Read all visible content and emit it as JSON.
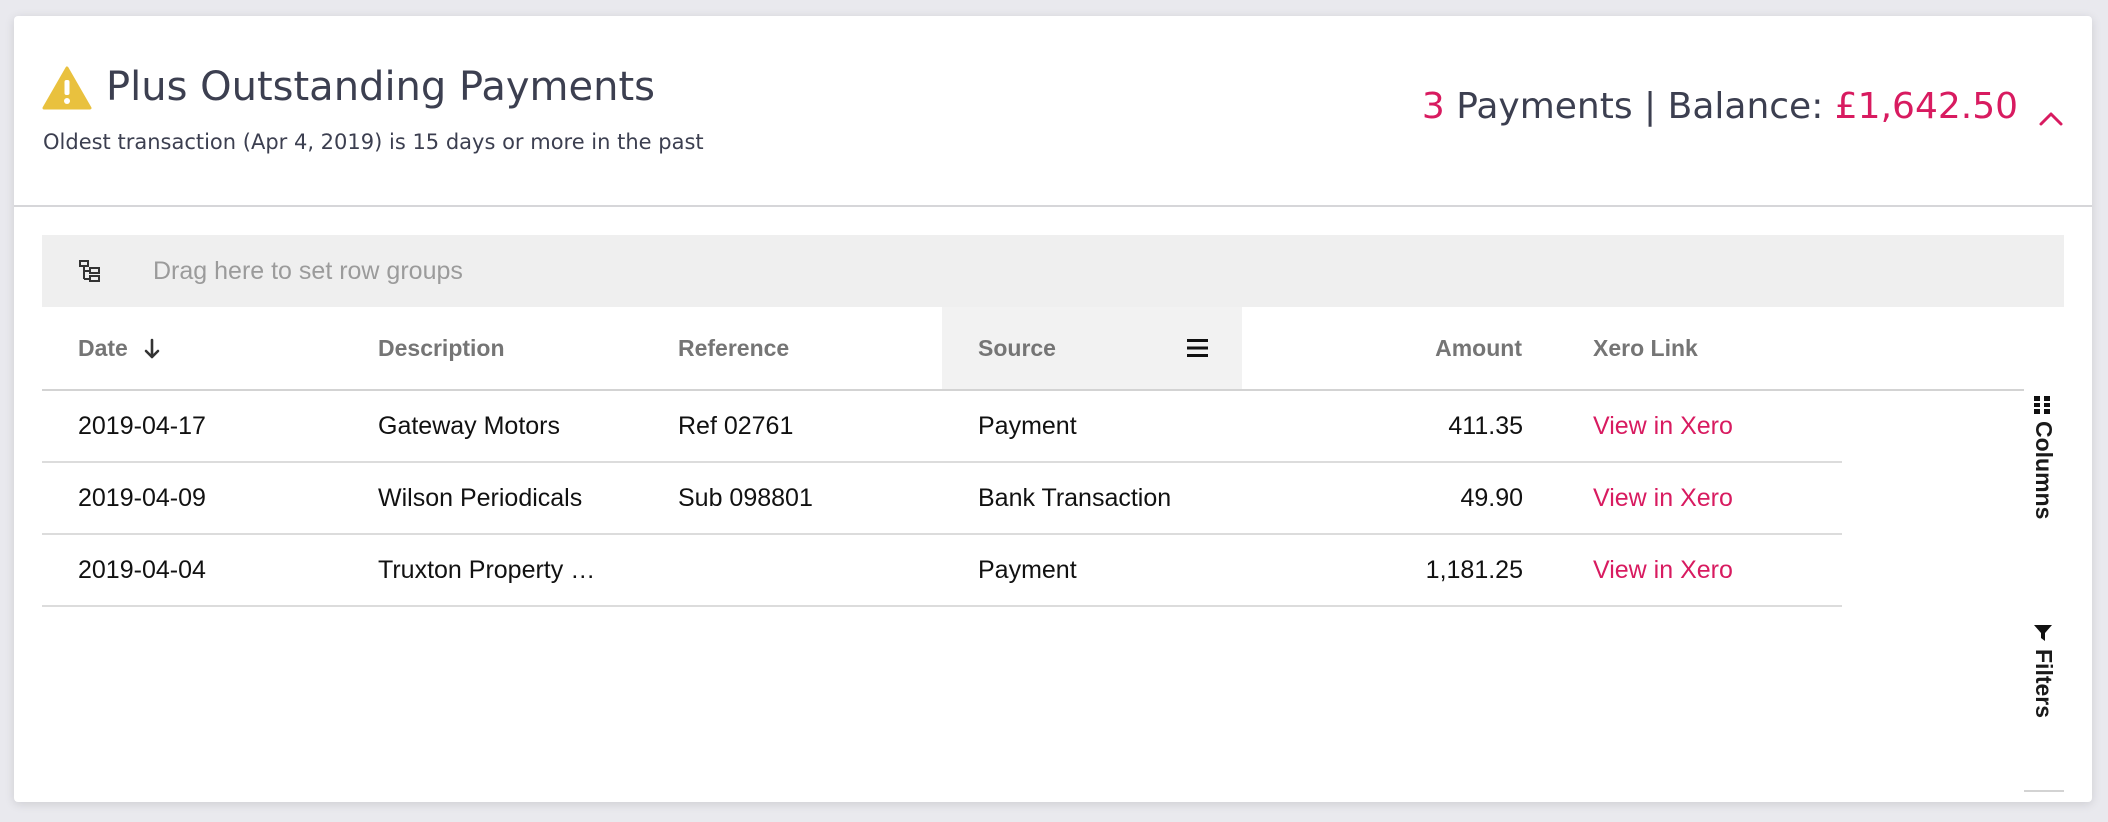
{
  "panel": {
    "title": "Plus Outstanding Payments",
    "subtitle": "Oldest transaction (Apr 4, 2019) is 15 days or more in the past",
    "icon": "warning-icon",
    "summary": {
      "count": "3",
      "text": " Payments | Balance: ",
      "balance": "£1,642.50"
    },
    "colors": {
      "accent": "#d81b60",
      "warning": "#e9c13e",
      "text": "#3c3f50"
    }
  },
  "grid": {
    "group_placeholder": "Drag here to set row groups",
    "columns": [
      {
        "label": "Date",
        "sort": "descending"
      },
      {
        "label": "Description"
      },
      {
        "label": "Reference"
      },
      {
        "label": "Source",
        "menu_open": true
      },
      {
        "label": "Amount"
      },
      {
        "label": "Xero Link"
      }
    ],
    "rows": [
      {
        "date": "2019-04-17",
        "description": "Gateway Motors",
        "reference": "Ref 02761",
        "source": "Payment",
        "amount": "411.35",
        "link": "View in Xero"
      },
      {
        "date": "2019-04-09",
        "description": "Wilson Periodicals",
        "reference": "Sub 098801",
        "source": "Bank Transaction",
        "amount": "49.90",
        "link": "View in Xero"
      },
      {
        "date": "2019-04-04",
        "description": "Truxton Property …",
        "reference": "",
        "source": "Payment",
        "amount": "1,181.25",
        "link": "View in Xero"
      }
    ],
    "side_bar": {
      "columns_label": "Columns",
      "filters_label": "Filters"
    }
  }
}
